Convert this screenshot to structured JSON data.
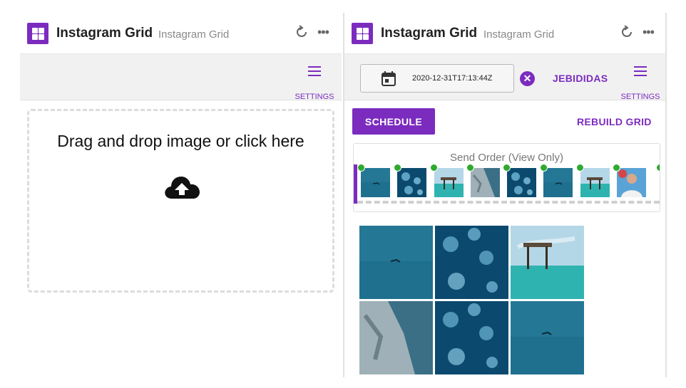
{
  "panels": {
    "left": {
      "title": "Instagram Grid",
      "subtitle": "Instagram Grid",
      "settings_label": "SETTINGS",
      "dropzone_text": "Drag and drop image or click here"
    },
    "right": {
      "title": "Instagram Grid",
      "subtitle": "Instagram Grid",
      "settings_label": "SETTINGS",
      "date_value": "2020-12-31T17:13:44Z",
      "account": "JEBIDIDAS",
      "schedule_label": "SCHEDULE",
      "rebuild_label": "REBUILD GRID",
      "send_order_label": "Send Order (View Only)"
    }
  },
  "colors": {
    "accent": "#7b2cbf",
    "status_dot": "#2eaa2e",
    "toolbar_bg": "#f1f1f1"
  },
  "icons": {
    "app": "grid-app-icon",
    "refresh": "refresh-icon",
    "more": "more-horizontal-icon",
    "settings": "hamburger-menu-icon",
    "upload": "cloud-upload-icon",
    "calendar": "calendar-icon",
    "clear": "clear-circle-icon"
  },
  "send_order_thumbs": [
    "ocean-swimmer",
    "jellyfish",
    "beach-hut",
    "rocky-cliff",
    "jellyfish",
    "ocean-swimmer",
    "beach-hut",
    "person-portrait"
  ],
  "grid_images": [
    "ocean-swimmer",
    "jellyfish",
    "beach-hut",
    "rocky-cliff",
    "jellyfish",
    "ocean-swimmer"
  ]
}
